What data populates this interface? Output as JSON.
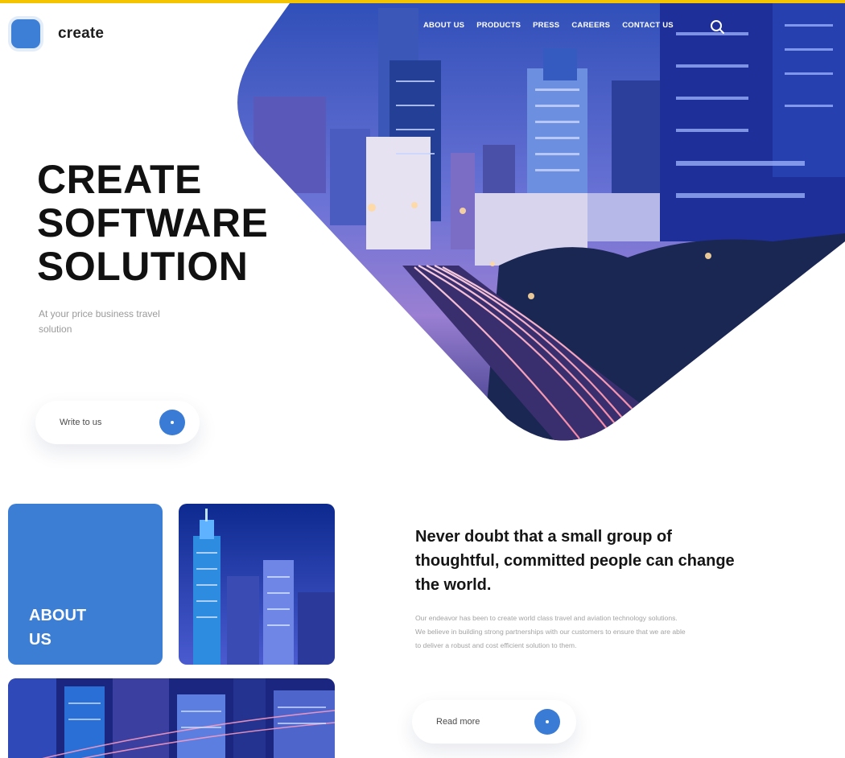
{
  "brand": {
    "name": "create"
  },
  "nav": {
    "items": [
      "ABOUT US",
      "PRODUCTS",
      "PRESS",
      "CAREERS",
      "CONTACT US"
    ],
    "search_icon": "search-icon"
  },
  "hero": {
    "title_lines": [
      "CREATE",
      "SOFTWARE",
      "SOLUTION"
    ],
    "subtitle": "At your price business travel solution",
    "cta_label": "Write to us"
  },
  "about": {
    "tile_label": "ABOUT US",
    "quote": "Never doubt that a small group of thoughtful, committed people can change the world.",
    "body": "Our endeavor has been to create world class travel and aviation technology solutions. We believe in building strong partnerships with our customers to ensure that we are able to deliver a robust and cost efficient solution to them.",
    "cta_label": "Read more"
  },
  "colors": {
    "accent": "#3d7ed5",
    "top_strip": "#f5c400",
    "text_dark": "#111111",
    "text_muted": "#9a9a9a"
  }
}
